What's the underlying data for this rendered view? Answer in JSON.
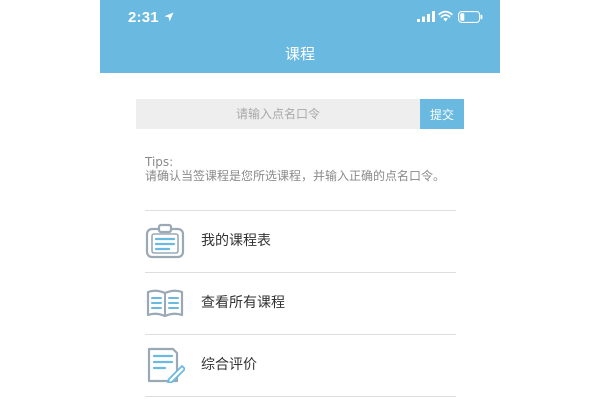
{
  "status_bar": {
    "time": "2:31",
    "icons": [
      "location-arrow-icon",
      "signal-icon",
      "wifi-icon",
      "battery-icon"
    ]
  },
  "header": {
    "title": "课程"
  },
  "checkin": {
    "placeholder": "请输入点名口令",
    "value": "",
    "submit_label": "提交"
  },
  "tips": {
    "title": "Tips:",
    "body": "请确认当签课程是您所选课程，并输入正确的点名口令。"
  },
  "menu": {
    "items": [
      {
        "label": "我的课程表",
        "icon": "clipboard-list-icon"
      },
      {
        "label": "查看所有课程",
        "icon": "open-book-icon"
      },
      {
        "label": "综合评价",
        "icon": "document-edit-icon"
      }
    ]
  },
  "colors": {
    "accent": "#6ab9e0",
    "input_bg": "#eeeeee",
    "tips_text": "#8a8a8a",
    "icon_stroke": "#9aa9b5",
    "icon_accent": "#6ab9e0"
  }
}
